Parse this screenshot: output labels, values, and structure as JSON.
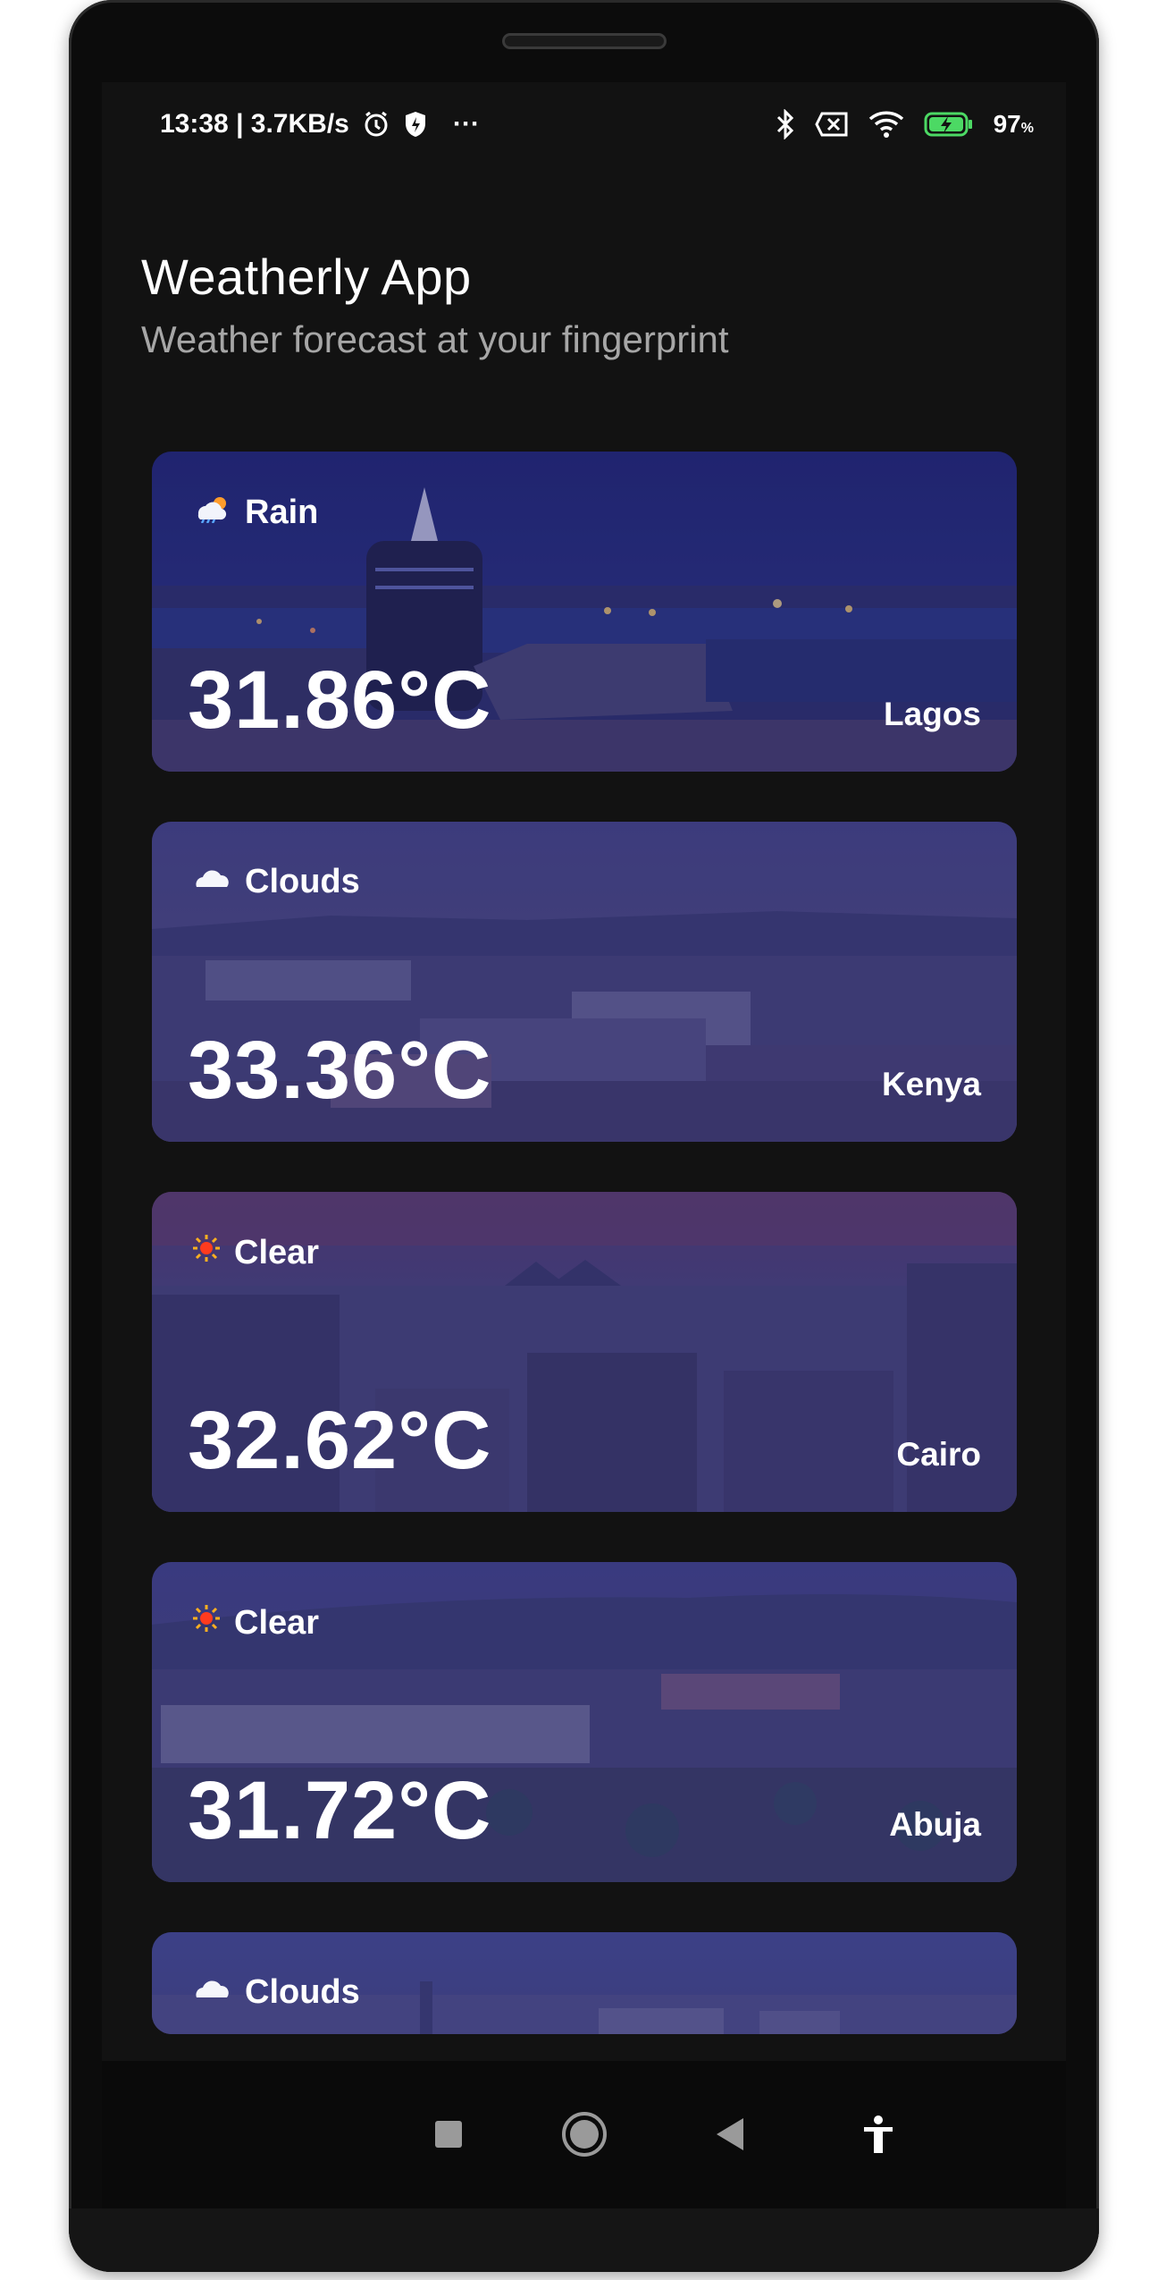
{
  "status_bar": {
    "time_speed": "13:38 | 3.7KB/s",
    "more": "···",
    "battery_percent": "97",
    "battery_unit": "%",
    "icons": [
      "alarm-icon",
      "shield-icon",
      "bluetooth-icon",
      "sim-off-icon",
      "wifi-icon",
      "battery-charging-icon"
    ]
  },
  "header": {
    "title": "Weatherly App",
    "subtitle": "Weather forecast at your fingerprint"
  },
  "cards": [
    {
      "condition": "Rain",
      "icon": "rain-sun-icon",
      "temperature": "31.86°C",
      "city": "Lagos"
    },
    {
      "condition": "Clouds",
      "icon": "cloud-icon",
      "temperature": "33.36°C",
      "city": "Kenya"
    },
    {
      "condition": "Clear",
      "icon": "sun-icon",
      "temperature": "32.62°C",
      "city": "Cairo"
    },
    {
      "condition": "Clear",
      "icon": "sun-icon",
      "temperature": "31.72°C",
      "city": "Abuja"
    },
    {
      "condition": "Clouds",
      "icon": "cloud-icon"
    }
  ],
  "nav_bar": {
    "buttons": [
      "recents-square-icon",
      "home-circle-icon",
      "back-triangle-icon",
      "accessibility-icon"
    ]
  },
  "colors": {
    "screen_bg": "#121212",
    "card_tint": "#3b3a7a",
    "text_primary": "#ffffff",
    "text_secondary": "#a6a6a6"
  }
}
